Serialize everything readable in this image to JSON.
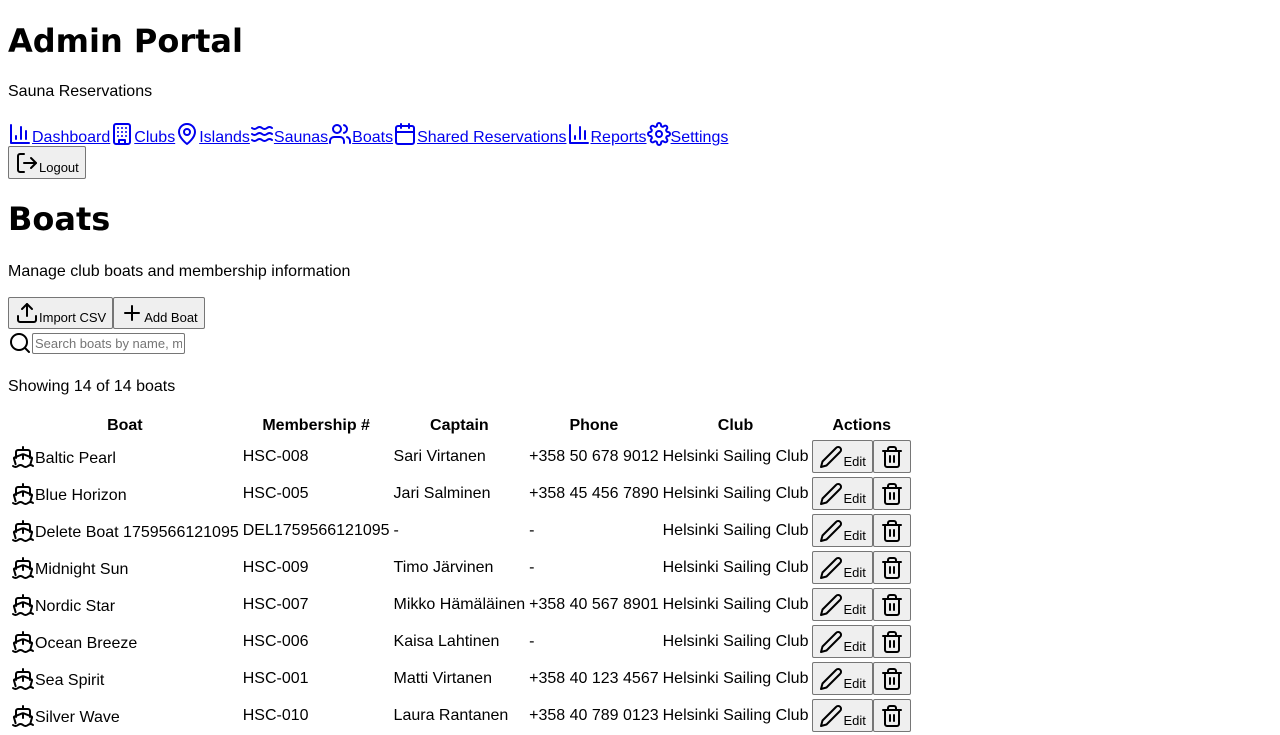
{
  "app": {
    "title": "Admin Portal",
    "subtitle": "Sauna Reservations"
  },
  "nav": {
    "dashboard": "Dashboard",
    "clubs": "Clubs",
    "islands": "Islands",
    "saunas": "Saunas",
    "boats": "Boats",
    "shared": "Shared Reservations",
    "reports": "Reports",
    "settings": "Settings"
  },
  "logout_label": "Logout",
  "page": {
    "title": "Boats",
    "description": "Manage club boats and membership information",
    "import_label": "Import CSV",
    "add_label": "Add Boat",
    "search_placeholder": "Search boats by name, membership #, captain...",
    "showing": "Showing 14 of 14 boats"
  },
  "table": {
    "headers": [
      "Boat",
      "Membership #",
      "Captain",
      "Phone",
      "Club",
      "Actions"
    ],
    "edit_label": "Edit",
    "rows": [
      {
        "boat": "Baltic Pearl",
        "membership": "HSC-008",
        "captain": "Sari Virtanen",
        "phone": "+358 50 678 9012",
        "club": "Helsinki Sailing Club"
      },
      {
        "boat": "Blue Horizon",
        "membership": "HSC-005",
        "captain": "Jari Salminen",
        "phone": "+358 45 456 7890",
        "club": "Helsinki Sailing Club"
      },
      {
        "boat": "Delete Boat 1759566121095",
        "membership": "DEL1759566121095",
        "captain": "-",
        "phone": "-",
        "club": "Helsinki Sailing Club"
      },
      {
        "boat": "Midnight Sun",
        "membership": "HSC-009",
        "captain": "Timo Järvinen",
        "phone": "-",
        "club": "Helsinki Sailing Club"
      },
      {
        "boat": "Nordic Star",
        "membership": "HSC-007",
        "captain": "Mikko Hämäläinen",
        "phone": "+358 40 567 8901",
        "club": "Helsinki Sailing Club"
      },
      {
        "boat": "Ocean Breeze",
        "membership": "HSC-006",
        "captain": "Kaisa Lahtinen",
        "phone": "-",
        "club": "Helsinki Sailing Club"
      },
      {
        "boat": "Sea Spirit",
        "membership": "HSC-001",
        "captain": "Matti Virtanen",
        "phone": "+358 40 123 4567",
        "club": "Helsinki Sailing Club"
      },
      {
        "boat": "Silver Wave",
        "membership": "HSC-010",
        "captain": "Laura Rantanen",
        "phone": "+358 40 789 0123",
        "club": "Helsinki Sailing Club"
      }
    ]
  }
}
